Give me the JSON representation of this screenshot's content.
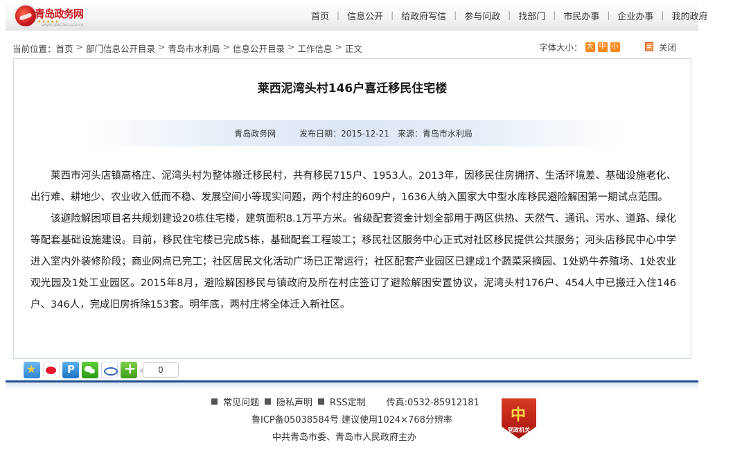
{
  "header": {
    "logo_text": "青岛政务网",
    "logo_stars": "★★★★★",
    "logo_sub": "WWW.QINGDAO.GOV.CN",
    "nav": [
      "首页",
      "信息公开",
      "给政府写信",
      "参与问政",
      "找部门",
      "市民办事",
      "企业办事",
      "我的政府"
    ]
  },
  "breadcrumb": {
    "prefix": "当前位置：",
    "items": [
      "首页",
      "部门信息公开目录",
      "青岛市水利局",
      "信息公开目录",
      "工作信息",
      "正文"
    ],
    "separator": ">"
  },
  "toolbar": {
    "font_size_label": "字体大小：",
    "font_sizes": [
      "大",
      "中",
      "小"
    ],
    "close_label": "关闭"
  },
  "article": {
    "title": "莱西泥湾头村146户喜迁移民住宅楼",
    "source_site": "青岛政务网",
    "publish_date": "发布日期：2015-12-21",
    "source": "来源：青岛市水利局",
    "paragraphs": [
      "莱西市河头店镇高格庄、泥湾头村为整体搬迁移民村，共有移民715户、1953人。2013年，因移民住房拥挤、生活环境差、基础设施老化、出行难、耕地少、农业收入低而不稳、发展空间小等现实问题，两个村庄的609户，1636人纳入国家大中型水库移民避险解困第一期试点范围。",
      "该避险解困项目名共规划建设20栋住宅楼，建筑面积8.1万平方米。省级配套资金计划全部用于两区供热、天然气、通讯、污水、道路、绿化等配套基础设施建设。目前，移民住宅楼已完成5栋，基础配套工程竣工；移民社区服务中心正式对社区移民提供公共服务；河头店移民中心中学进入室内外装修阶段；商业网点已完工；社区居民文化活动广场已正常运行；社区配套产业园区已建成1个蔬菜采摘园、1处奶牛养殖场、1处农业观光园及1处工业园区。2015年8月，避险解困移民与镇政府及所在村庄签订了避险解困安置协议，泥湾头村176户、454人中已搬迁入住146户、346人，完成旧房拆除153套。明年底，两村庄将全体迁入新社区。"
    ]
  },
  "share": {
    "icons": [
      "qzone-icon",
      "weibo-icon",
      "pinterest-icon",
      "wechat-icon",
      "renren-icon",
      "more-icon"
    ],
    "count": "0"
  },
  "footer": {
    "links": [
      "常见问题",
      "隐私声明",
      "RSS定制"
    ],
    "fax": "传真:0532-85912181",
    "icp": "鲁ICP备05038584号  建议使用1024×768分辨率",
    "host": "中共青岛市委、青岛市人民政府主办",
    "badge_text": "党政机关",
    "badge_emblem": "中"
  }
}
